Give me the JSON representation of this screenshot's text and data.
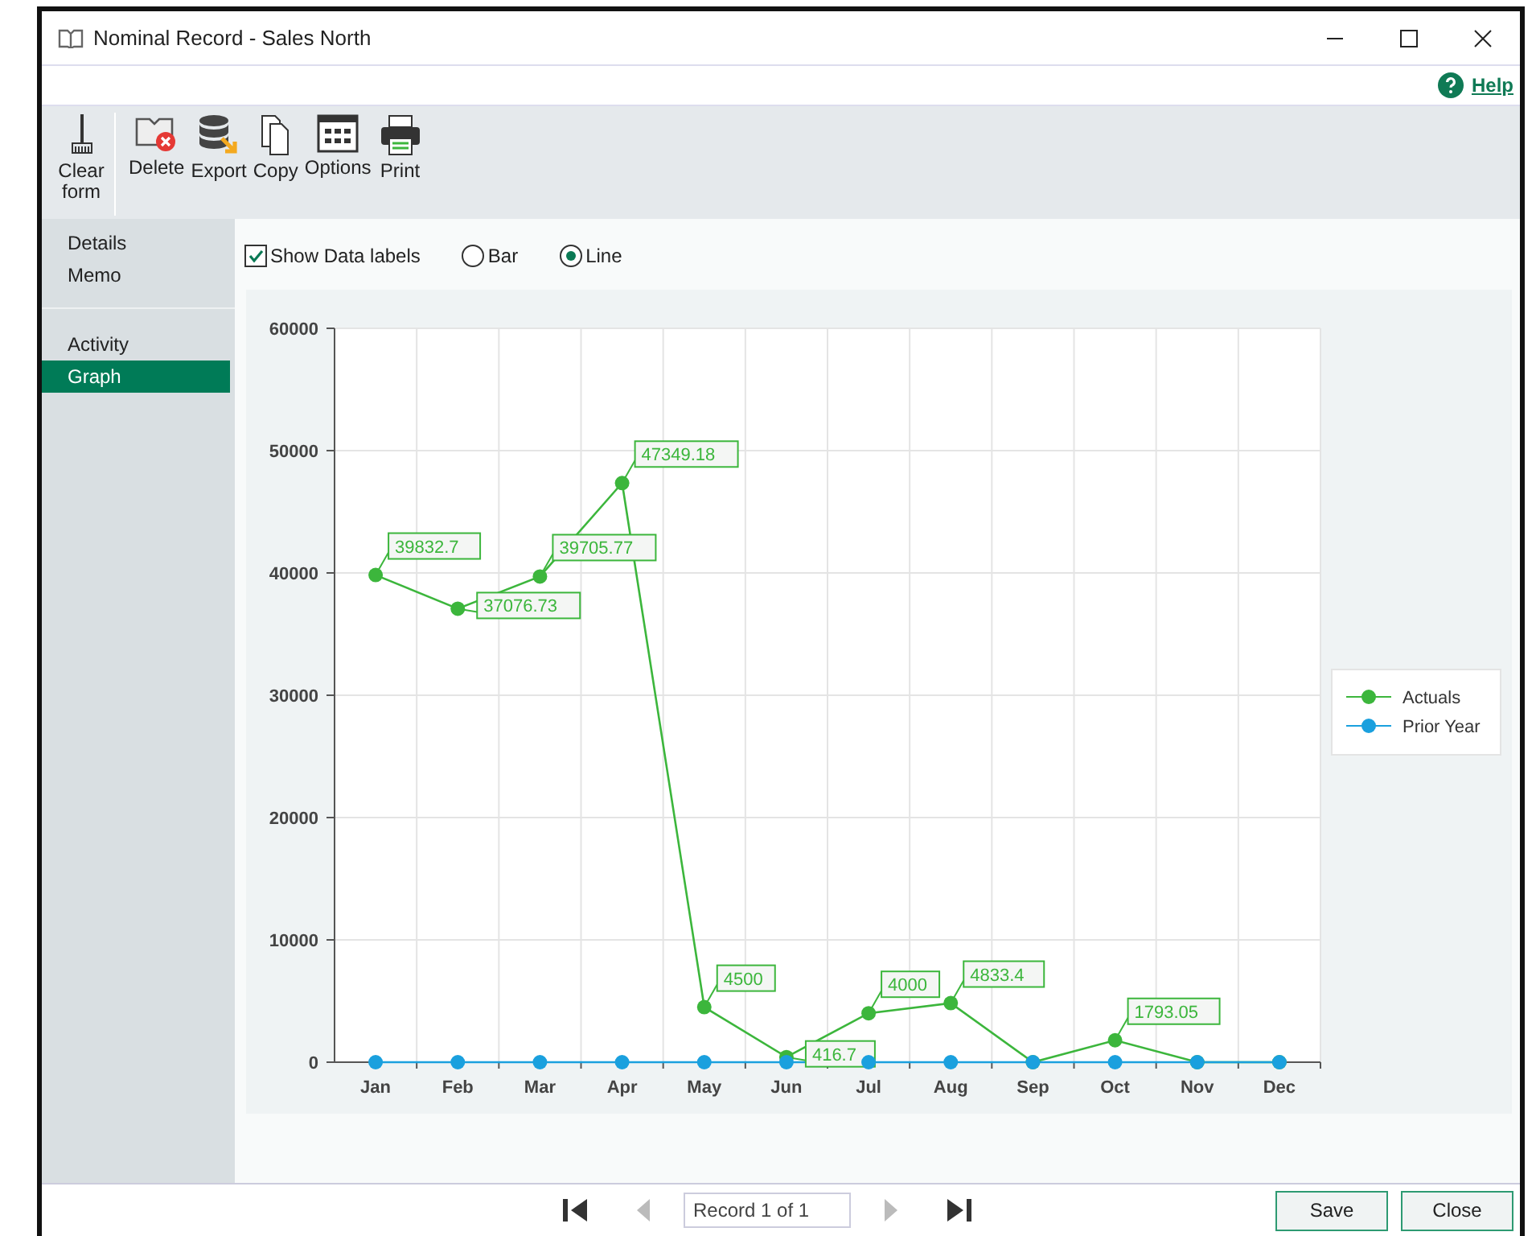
{
  "window": {
    "title": "Nominal Record - Sales North"
  },
  "help": {
    "label": "Help"
  },
  "toolbar": [
    {
      "kind": "clear",
      "label": "Clear form"
    },
    {
      "kind": "delete",
      "label": "Delete"
    },
    {
      "kind": "export",
      "label": "Export"
    },
    {
      "kind": "copy",
      "label": "Copy"
    },
    {
      "kind": "options",
      "label": "Options"
    },
    {
      "kind": "print",
      "label": "Print"
    }
  ],
  "sidebar": {
    "groups": [
      [
        {
          "label": "Details",
          "selected": false
        },
        {
          "label": "Memo",
          "selected": false
        }
      ],
      [
        {
          "label": "Activity",
          "selected": false
        },
        {
          "label": "Graph",
          "selected": true
        }
      ]
    ]
  },
  "options": {
    "show_data_labels": {
      "label": "Show Data labels",
      "checked": true
    },
    "chart_types": [
      {
        "label": "Bar",
        "selected": false
      },
      {
        "label": "Line",
        "selected": true
      }
    ]
  },
  "graph": {
    "chart_data": {
      "type": "line",
      "categories": [
        "Jan",
        "Feb",
        "Mar",
        "Apr",
        "May",
        "Jun",
        "Jul",
        "Aug",
        "Sep",
        "Oct",
        "Nov",
        "Dec"
      ],
      "series": [
        {
          "name": "Actuals",
          "color": "#3cb63c",
          "marker": "circle",
          "values": [
            39832.7,
            37076.73,
            39705.77,
            47349.18,
            4500,
            416.7,
            4000,
            4833.4,
            0,
            1793.05,
            0,
            0
          ],
          "value_labels": [
            "39832.7",
            "37076.73",
            "39705.77",
            "47349.18",
            "4500",
            "416.7",
            "4000",
            "4833.4",
            null,
            "1793.05",
            null,
            null
          ]
        },
        {
          "name": "Prior Year",
          "color": "#1aa0de",
          "marker": "circle",
          "values": [
            0,
            0,
            0,
            0,
            0,
            0,
            0,
            0,
            0,
            0,
            0,
            0
          ],
          "value_labels": [
            null,
            null,
            null,
            null,
            null,
            null,
            null,
            null,
            null,
            null,
            null,
            null
          ]
        }
      ],
      "ylim": [
        0,
        60000
      ],
      "yticks": [
        0,
        10000,
        20000,
        30000,
        40000,
        50000,
        60000
      ],
      "grid": true,
      "legend": true
    }
  },
  "footer": {
    "record": "Record 1 of 1",
    "prev_disabled": true,
    "next_disabled": true,
    "buttons": [
      "Save",
      "Close"
    ]
  }
}
